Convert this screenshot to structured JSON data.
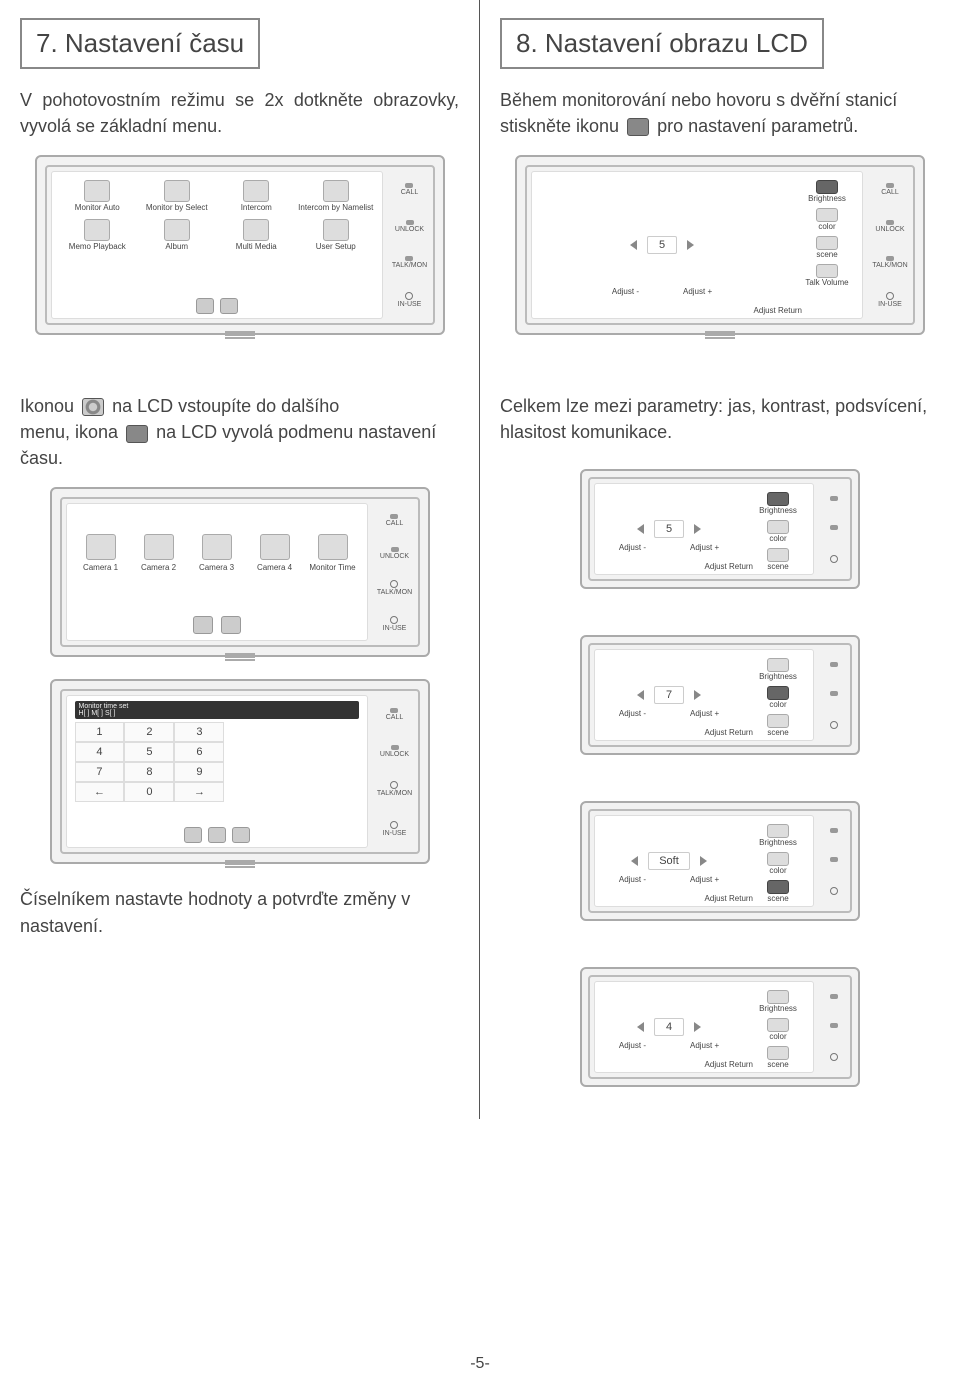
{
  "section7": {
    "title": "7. Nastavení času",
    "body": "V pohotovostním režimu se 2x dotkněte obrazovky, vyvolá se základní menu.",
    "menu_items": [
      "Monitor Auto",
      "Monitor by Select",
      "Intercom",
      "Intercom by Namelist",
      "Memo Playback",
      "Album",
      "Multi Media",
      "User Setup"
    ],
    "leds": {
      "call": "CALL",
      "unlock": "UNLOCK",
      "talkmon": "TALK/MON",
      "inuse": "IN-USE"
    },
    "mid_text_1": "Ikonou",
    "mid_text_2": "na LCD vstoupíte do dalšího",
    "mid_text_3": "menu, ikona",
    "mid_text_4": "na LCD vyvolá podmenu nastavení času.",
    "cameras": [
      "Camera 1",
      "Camera 2",
      "Camera 3",
      "Camera 4",
      "Monitor Time"
    ],
    "keypad": {
      "header": "Monitor time set",
      "header2": "H[ ]   M[ ]   S[ ]",
      "keys": [
        "1",
        "2",
        "3",
        "4",
        "5",
        "6",
        "7",
        "8",
        "9",
        "←",
        "0",
        "→"
      ]
    },
    "bottom_text": "Číselníkem nastavte hodnoty a potvrďte změny v nastavení."
  },
  "section8": {
    "title": "8. Nastavení obrazu LCD",
    "body_1": "Během monitorování nebo hovoru s dvěřní stanicí stiskněte ikonu",
    "body_2": "pro nastavení parametrů.",
    "params": {
      "brightness": "Brightness",
      "color": "color",
      "scene": "scene",
      "talk_volume": "Talk Volume",
      "adjust_return": "Adjust Return",
      "adjust_minus": "Adjust -",
      "adjust_plus": "Adjust +"
    },
    "adjust_values": {
      "main": "5",
      "p1": "5",
      "p2": "7",
      "p3": "Soft",
      "p4": "4"
    },
    "mid_text": "Celkem lze mezi parametry: jas, kontrast, podsvícení, hlasitost komunikace."
  },
  "page_number": "-5-"
}
